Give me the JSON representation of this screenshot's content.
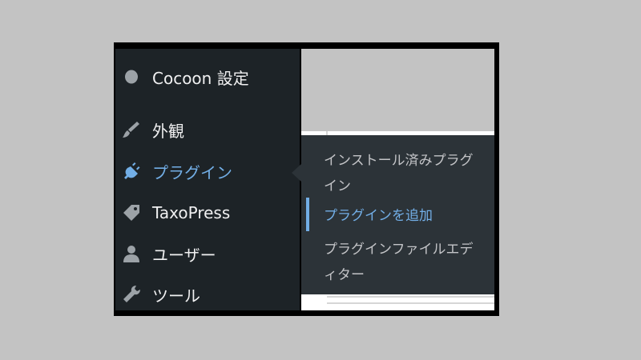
{
  "sidebar": {
    "items": [
      {
        "label": "Cocoon 設定",
        "icon": "cocoon-circle-icon"
      },
      {
        "label": "外観",
        "icon": "paintbrush-icon"
      },
      {
        "label": "プラグイン",
        "icon": "plugin-icon",
        "current": true
      },
      {
        "label": "TaxoPress",
        "icon": "tag-icon"
      },
      {
        "label": "ユーザー",
        "icon": "user-icon"
      },
      {
        "label": "ツール",
        "icon": "wrench-icon"
      }
    ]
  },
  "submenu": {
    "items": [
      {
        "label": "インストール済みプラグイン"
      },
      {
        "label": "プラグインを追加",
        "current": true
      },
      {
        "label": "プラグインファイルエディター"
      }
    ]
  },
  "colors": {
    "sidebar_bg": "#1d2327",
    "submenu_bg": "#2c3338",
    "accent": "#72aee6",
    "text": "#f0f0f1"
  }
}
